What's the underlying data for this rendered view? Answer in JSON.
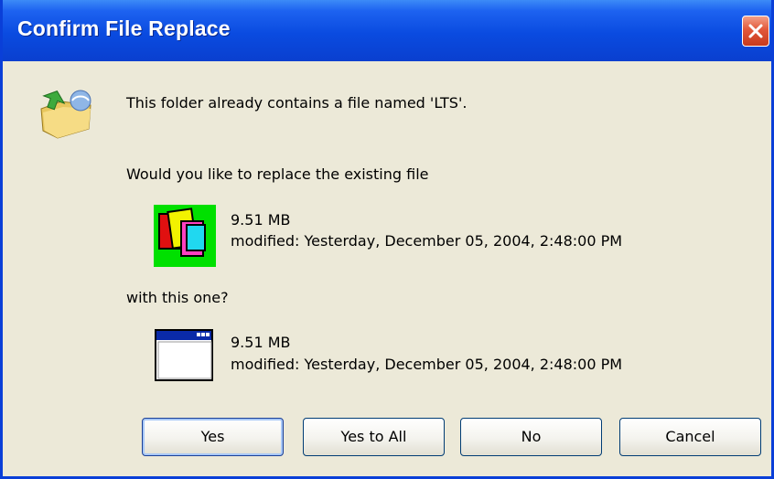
{
  "window": {
    "title": "Confirm File Replace"
  },
  "message": {
    "line1": "This folder already contains a file named 'LTS'.",
    "line2": "Would you like to replace the existing file",
    "line3": "with this one?"
  },
  "existing_file": {
    "size": "9.51 MB",
    "modified": "modified: Yesterday, December 05, 2004, 2:48:00 PM",
    "icon": "layered-files-icon"
  },
  "new_file": {
    "size": "9.51 MB",
    "modified": "modified: Yesterday, December 05, 2004, 2:48:00 PM",
    "icon": "application-window-icon"
  },
  "buttons": {
    "yes": "Yes",
    "yes_to_all": "Yes to All",
    "no": "No",
    "cancel": "Cancel"
  },
  "colors": {
    "titlebar": "#0A4BE0",
    "close": "#E2573A",
    "dialog_bg": "#ECE9D8"
  }
}
